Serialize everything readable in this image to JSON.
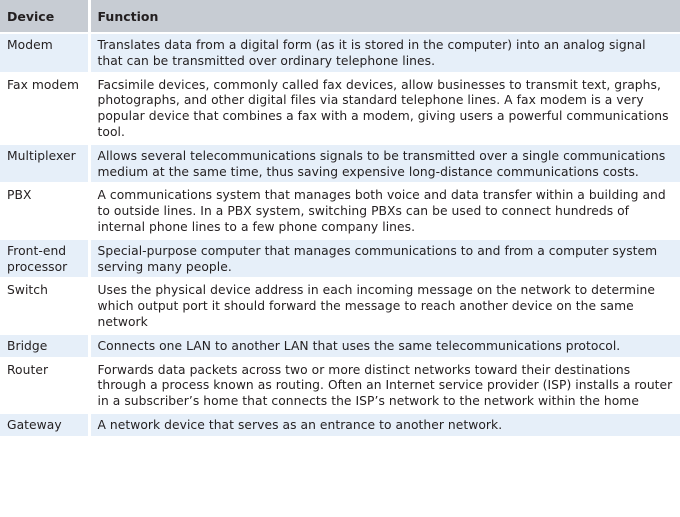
{
  "header": {
    "device": "Device",
    "function": "Function"
  },
  "rows": [
    {
      "device": "Modem",
      "function": "Translates data from a digital form (as it is stored in the computer) into an analog signal that can be transmitted over ordinary telephone lines."
    },
    {
      "device": "Fax modem",
      "function": "Facsimile devices, commonly called fax devices, allow businesses to transmit text, graphs, photographs, and other digital files via standard telephone lines. A fax modem is a very popular device that combines a fax with a modem, giving users a powerful communications tool."
    },
    {
      "device": "Multiplexer",
      "function": "Allows several telecommunications signals to be transmitted over a single communications medium at the same time, thus saving expensive long-distance communications costs."
    },
    {
      "device": "PBX",
      "function": "A communications system that manages both voice and data transfer within a building and to outside lines. In a PBX system, switching PBXs can be used to connect hundreds of internal phone lines to a few phone company lines."
    },
    {
      "device": "Front-end processor",
      "function": "Special-purpose computer that manages communications to and from a computer system serving many people."
    },
    {
      "device": "Switch",
      "function": "Uses the physical device address in each incoming message on the network to determine which output port it should forward the message to reach another device on the same network"
    },
    {
      "device": "Bridge",
      "function": "Connects one LAN to another LAN that uses the same telecommunications protocol."
    },
    {
      "device": "Router",
      "function": "Forwards data packets across two or more distinct networks toward their destinations through a process known as routing. Often an Internet service provider (ISP) installs a router in a subscriber’s home that connects the ISP’s network to the network within the home"
    },
    {
      "device": "Gateway",
      "function": "A network device that serves as an entrance to another network."
    }
  ]
}
